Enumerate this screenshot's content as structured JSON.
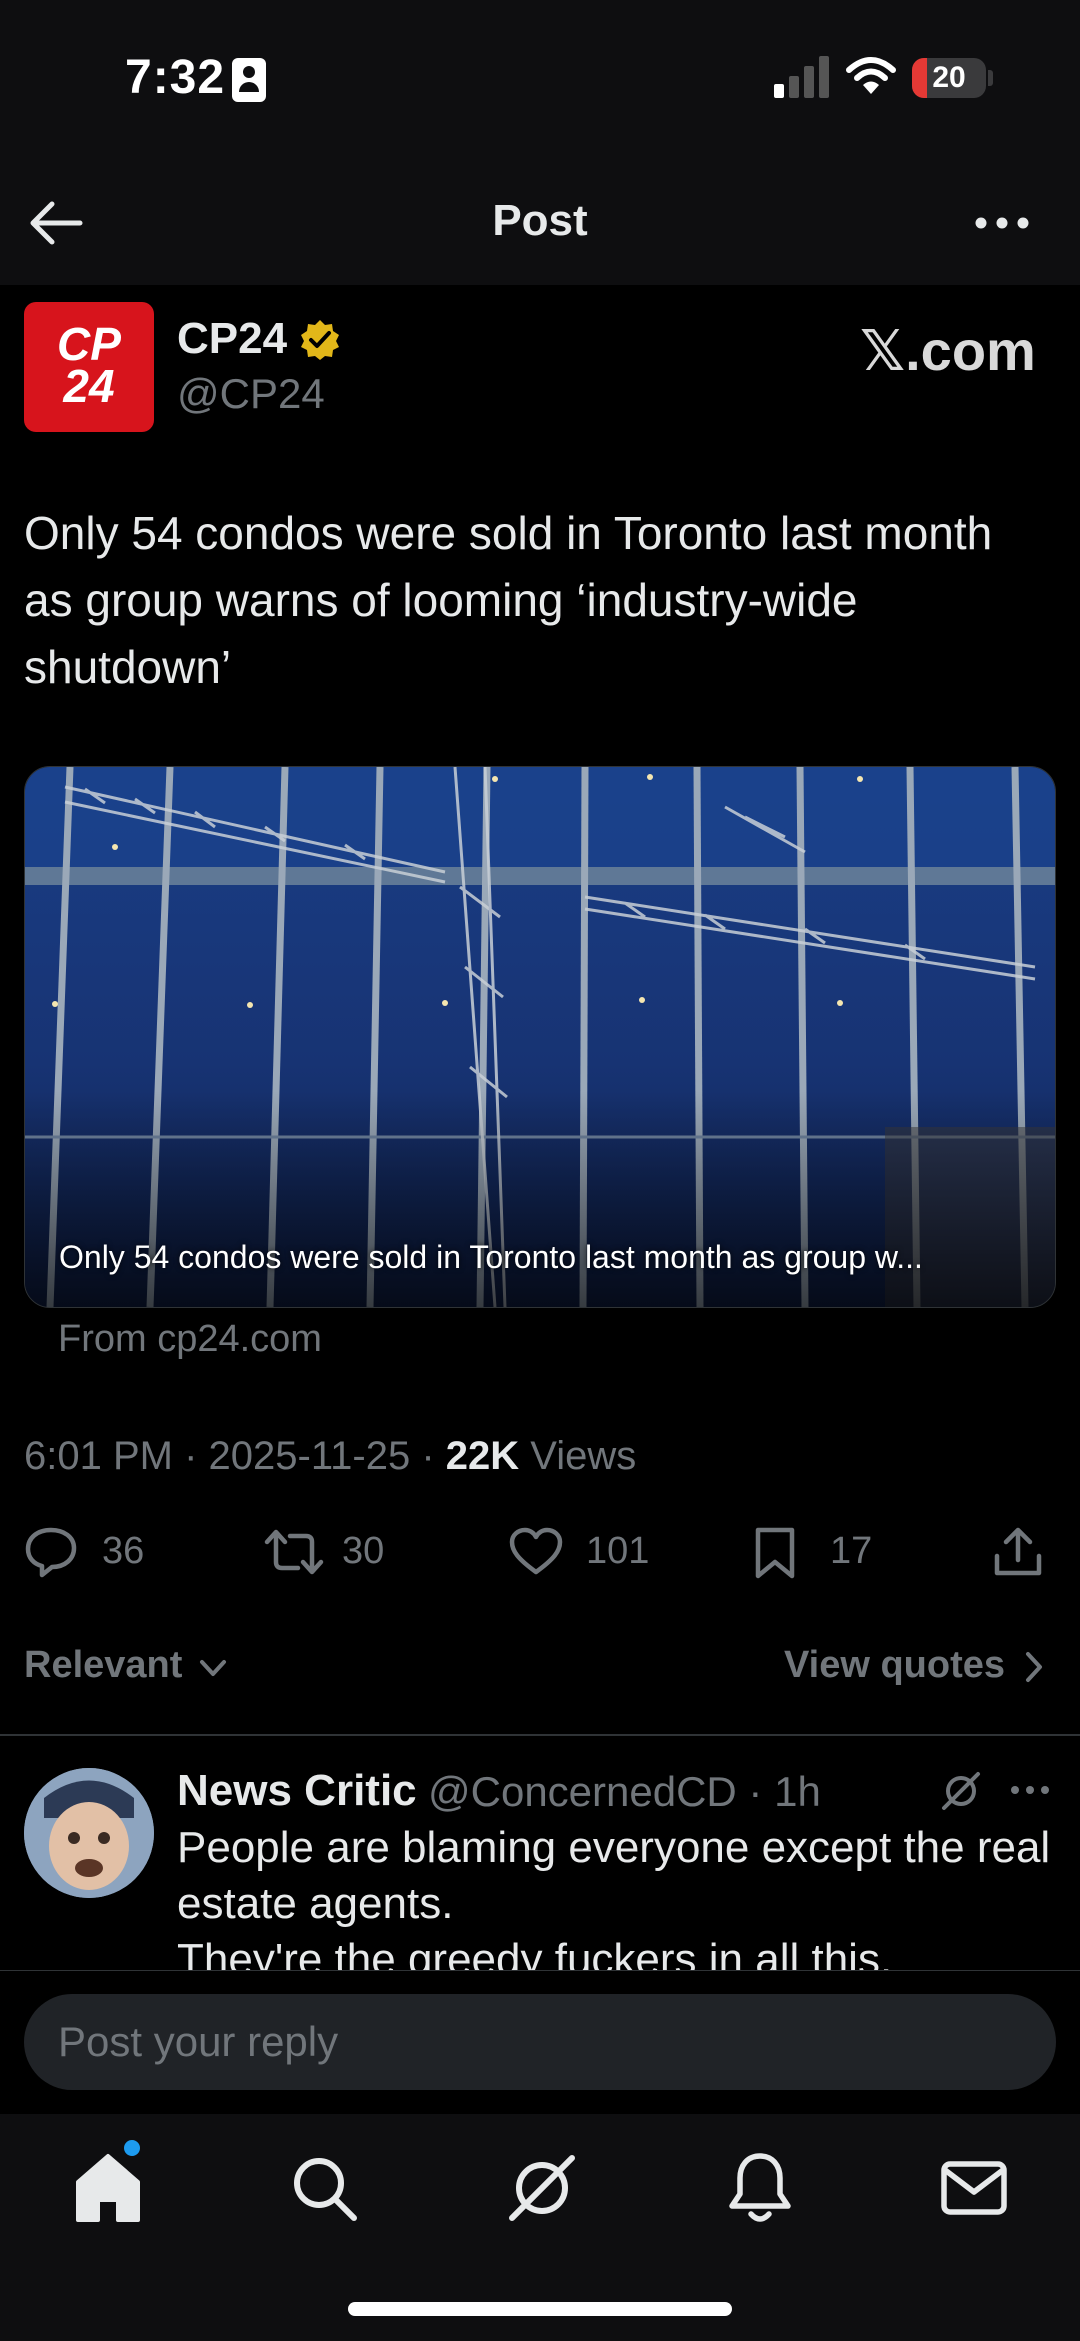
{
  "status_bar": {
    "time": "7:32",
    "battery_level": "20",
    "battery_fraction": 0.2,
    "battery_color": "#e53935"
  },
  "header": {
    "title": "Post",
    "back_icon": "arrow-left-icon",
    "more_icon": "more-horizontal-icon"
  },
  "author": {
    "avatar_text_top": "CP",
    "avatar_text_bottom": "24",
    "avatar_color": "#d7141c",
    "name": "CP24",
    "handle": "@CP24",
    "verified_badge": "gold-verified-icon",
    "verified_color": "#e2b719"
  },
  "watermark": "𝕏.com",
  "post": {
    "text": "Only 54 condos were sold in Toronto last month as group warns of looming ‘industry-wide shutdown’"
  },
  "link_card": {
    "caption": "Only 54 condos were sold in Toronto last month as group w...",
    "source": "From cp24.com"
  },
  "meta": {
    "time": "6:01 PM",
    "date": "2025-11-25",
    "separator": "·",
    "views_count": "22K",
    "views_label": "Views"
  },
  "actions": {
    "reply_count": "36",
    "repost_count": "30",
    "like_count": "101",
    "bookmark_count": "17"
  },
  "sort": {
    "relevant_label": "Relevant",
    "view_quotes_label": "View quotes"
  },
  "reply": {
    "name": "News Critic",
    "handle_time": "@ConcernedCD · 1h",
    "text_line1": "People are blaming everyone except the real estate agents.",
    "text_line2": "They're the greedy fuckers in all this."
  },
  "reply_input": {
    "placeholder": "Post your reply"
  },
  "tab_bar": {
    "tabs": [
      "home-icon",
      "search-icon",
      "grok-icon",
      "bell-icon",
      "mail-icon"
    ],
    "accent": "#1d9bf0"
  }
}
